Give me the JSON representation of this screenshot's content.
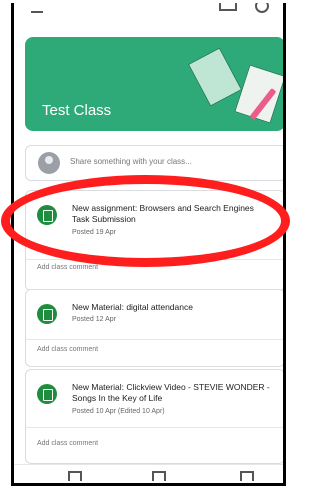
{
  "class": {
    "title": "Test Class"
  },
  "composer": {
    "placeholder": "Share something with your class..."
  },
  "stream": [
    {
      "title": "New assignment: Browsers and Search Engines Task Submission",
      "date": "Posted 19 Apr",
      "comment_label": "Add class comment"
    },
    {
      "title": "New Material: digital attendance",
      "date": "Posted 12 Apr",
      "comment_label": "Add class comment"
    },
    {
      "title": "New Material: Clickview Video - STEVIE WONDER - Songs In the Key of Life",
      "date": "Posted 10 Apr (Edited 10 Apr)",
      "comment_label": "Add class comment"
    }
  ],
  "theme": {
    "banner_color": "#2eaa78",
    "icon_color": "#1e8e3e",
    "highlight_color": "#ff1e1e"
  },
  "icons": {
    "menu": "menu-icon",
    "calendar": "calendar-icon",
    "account": "account-icon",
    "post": "assignment-icon"
  }
}
